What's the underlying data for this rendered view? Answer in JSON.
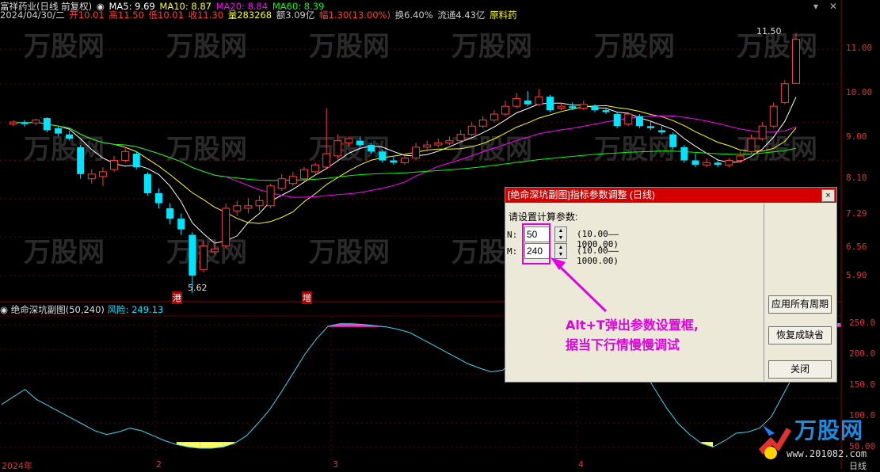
{
  "header": {
    "stock_name": "富祥药业(日线 前复权)",
    "ma5": "MA5: 9.69",
    "ma10": "MA10: 8.87",
    "ma20": "MA20: 8.84",
    "ma60": "MA60: 8.39",
    "date": "2024/04/30/二",
    "open": "开10.01",
    "high": "高11.50",
    "low": "低10.01",
    "close": "收11.30",
    "volume": "量283268",
    "amount": "额3.09亿",
    "change": "幅1.30(13.00%)",
    "turnover": "换6.40%",
    "float": "流通4.43亿",
    "sector": "原料药",
    "close_icon": "close-icon",
    "menu_icon": "chevron-down-icon"
  },
  "price_axis": [
    "11.00",
    "10.00",
    "9.00",
    "8.10",
    "7.29",
    "6.56",
    "5.90"
  ],
  "markers": {
    "high_label": "11.50",
    "low_label": "5.62",
    "tag1": "港",
    "tag2": "增"
  },
  "indicator": {
    "title": "绝命深坑副图(50,240)",
    "risk_label": "风险: 249.13",
    "axis": [
      "250.0",
      "200.0",
      "150.0",
      "100.0",
      "50.00"
    ]
  },
  "bottom_labels": [
    "2024年",
    "2",
    "3",
    "4",
    "日线"
  ],
  "dialog": {
    "title": "[绝命深坑副图]指标参数调整 (日线)",
    "close_label": "×",
    "prompt": "请设置计算参数:",
    "params": [
      {
        "name": "N:",
        "value": "50",
        "range": "(10.00——1000.00)"
      },
      {
        "name": "M:",
        "value": "240",
        "range": "(10.00——1000.00)"
      }
    ],
    "buttons": {
      "apply_all": "应用所有周期",
      "restore": "恢复成缺省",
      "close": "关闭"
    }
  },
  "annotation": {
    "line1": "Alt+T弹出参数设置框,",
    "line2": "据当下行情慢慢调试"
  },
  "logo": {
    "name": "万股网",
    "url": "www.201082.com"
  },
  "colors": {
    "up": "#ff3b3b",
    "down": "#00e5ff",
    "ma5": "#ffffff",
    "ma10": "#ffff00",
    "ma20": "#ff00ff",
    "ma60": "#00ff00",
    "dialog_title": "#d40000",
    "annotation": "#e000e0"
  },
  "candles": [
    {
      "o": 8.95,
      "c": 9.0,
      "h": 9.05,
      "l": 8.9
    },
    {
      "o": 9.0,
      "c": 8.95,
      "h": 9.05,
      "l": 8.88
    },
    {
      "o": 8.98,
      "c": 9.05,
      "h": 9.08,
      "l": 8.92
    },
    {
      "o": 9.1,
      "c": 8.8,
      "h": 9.12,
      "l": 8.75
    },
    {
      "o": 8.85,
      "c": 8.72,
      "h": 8.9,
      "l": 8.65
    },
    {
      "o": 8.7,
      "c": 8.6,
      "h": 8.78,
      "l": 8.55
    },
    {
      "o": 8.4,
      "c": 7.8,
      "h": 8.45,
      "l": 7.7
    },
    {
      "o": 7.7,
      "c": 7.8,
      "h": 7.9,
      "l": 7.6
    },
    {
      "o": 7.75,
      "c": 7.85,
      "h": 7.95,
      "l": 7.55
    },
    {
      "o": 7.9,
      "c": 8.1,
      "h": 8.2,
      "l": 7.85
    },
    {
      "o": 8.1,
      "c": 8.3,
      "h": 8.4,
      "l": 8.05
    },
    {
      "o": 8.25,
      "c": 7.95,
      "h": 8.3,
      "l": 7.9
    },
    {
      "o": 7.8,
      "c": 7.4,
      "h": 7.85,
      "l": 7.35
    },
    {
      "o": 7.4,
      "c": 7.2,
      "h": 7.5,
      "l": 7.1
    },
    {
      "o": 7.1,
      "c": 6.9,
      "h": 7.2,
      "l": 6.8
    },
    {
      "o": 6.9,
      "c": 6.7,
      "h": 7.0,
      "l": 6.6
    },
    {
      "o": 6.6,
      "c": 5.9,
      "h": 6.65,
      "l": 5.62
    },
    {
      "o": 6.0,
      "c": 6.4,
      "h": 6.5,
      "l": 5.95
    },
    {
      "o": 6.3,
      "c": 6.35,
      "h": 6.5,
      "l": 6.25
    },
    {
      "o": 6.4,
      "c": 7.1,
      "h": 7.2,
      "l": 6.35
    },
    {
      "o": 7.05,
      "c": 7.15,
      "h": 7.25,
      "l": 6.95
    },
    {
      "o": 7.1,
      "c": 7.15,
      "h": 7.3,
      "l": 7.0
    },
    {
      "o": 7.15,
      "c": 7.25,
      "h": 7.35,
      "l": 7.05
    },
    {
      "o": 7.15,
      "c": 7.55,
      "h": 7.6,
      "l": 7.1
    },
    {
      "o": 7.5,
      "c": 7.7,
      "h": 7.8,
      "l": 7.45
    },
    {
      "o": 7.6,
      "c": 7.75,
      "h": 7.85,
      "l": 7.55
    },
    {
      "o": 7.7,
      "c": 7.9,
      "h": 7.95,
      "l": 7.65
    },
    {
      "o": 7.85,
      "c": 8.0,
      "h": 8.05,
      "l": 7.8
    },
    {
      "o": 7.95,
      "c": 8.25,
      "h": 9.35,
      "l": 7.9
    },
    {
      "o": 8.2,
      "c": 8.55,
      "h": 8.7,
      "l": 8.15
    },
    {
      "o": 8.5,
      "c": 8.6,
      "h": 8.65,
      "l": 8.4
    },
    {
      "o": 8.55,
      "c": 8.45,
      "h": 8.65,
      "l": 8.4
    },
    {
      "o": 8.45,
      "c": 8.3,
      "h": 8.5,
      "l": 8.25
    },
    {
      "o": 8.3,
      "c": 8.1,
      "h": 8.35,
      "l": 8.05
    },
    {
      "o": 8.1,
      "c": 8.05,
      "h": 8.2,
      "l": 8.0
    },
    {
      "o": 8.05,
      "c": 8.15,
      "h": 8.25,
      "l": 8.0
    },
    {
      "o": 8.15,
      "c": 8.4,
      "h": 8.5,
      "l": 8.1
    },
    {
      "o": 8.4,
      "c": 8.45,
      "h": 8.55,
      "l": 8.3
    },
    {
      "o": 8.45,
      "c": 8.5,
      "h": 8.6,
      "l": 8.4
    },
    {
      "o": 8.5,
      "c": 8.55,
      "h": 8.65,
      "l": 8.45
    },
    {
      "o": 8.55,
      "c": 8.7,
      "h": 8.8,
      "l": 8.5
    },
    {
      "o": 8.7,
      "c": 8.9,
      "h": 9.0,
      "l": 8.65
    },
    {
      "o": 8.9,
      "c": 9.05,
      "h": 9.15,
      "l": 8.85
    },
    {
      "o": 9.05,
      "c": 9.2,
      "h": 9.3,
      "l": 9.0
    },
    {
      "o": 9.2,
      "c": 9.4,
      "h": 9.55,
      "l": 9.15
    },
    {
      "o": 9.4,
      "c": 9.6,
      "h": 9.75,
      "l": 9.35
    },
    {
      "o": 9.55,
      "c": 9.45,
      "h": 9.8,
      "l": 9.4
    },
    {
      "o": 9.45,
      "c": 9.65,
      "h": 9.85,
      "l": 9.4
    },
    {
      "o": 9.65,
      "c": 9.3,
      "h": 9.7,
      "l": 9.25
    },
    {
      "o": 9.35,
      "c": 9.4,
      "h": 9.5,
      "l": 9.3
    },
    {
      "o": 9.4,
      "c": 9.35,
      "h": 9.5,
      "l": 9.3
    },
    {
      "o": 9.35,
      "c": 9.45,
      "h": 9.55,
      "l": 9.3
    },
    {
      "o": 9.4,
      "c": 9.3,
      "h": 9.45,
      "l": 9.25
    },
    {
      "o": 9.3,
      "c": 9.25,
      "h": 9.35,
      "l": 9.2
    },
    {
      "o": 9.2,
      "c": 8.9,
      "h": 9.25,
      "l": 8.85
    },
    {
      "o": 8.95,
      "c": 9.2,
      "h": 9.25,
      "l": 8.9
    },
    {
      "o": 9.15,
      "c": 8.9,
      "h": 9.2,
      "l": 8.85
    },
    {
      "o": 8.9,
      "c": 8.85,
      "h": 9.0,
      "l": 8.8
    },
    {
      "o": 8.8,
      "c": 8.75,
      "h": 8.9,
      "l": 8.7
    },
    {
      "o": 8.7,
      "c": 8.4,
      "h": 8.75,
      "l": 8.35
    },
    {
      "o": 8.4,
      "c": 8.1,
      "h": 8.45,
      "l": 8.05
    },
    {
      "o": 8.1,
      "c": 8.0,
      "h": 8.25,
      "l": 7.95
    },
    {
      "o": 8.0,
      "c": 8.05,
      "h": 8.15,
      "l": 7.95
    },
    {
      "o": 8.05,
      "c": 8.0,
      "h": 8.1,
      "l": 7.95
    },
    {
      "o": 8.0,
      "c": 8.1,
      "h": 8.15,
      "l": 7.95
    },
    {
      "o": 8.1,
      "c": 8.2,
      "h": 8.3,
      "l": 8.05
    },
    {
      "o": 8.3,
      "c": 8.6,
      "h": 8.7,
      "l": 8.25
    },
    {
      "o": 8.6,
      "c": 8.9,
      "h": 9.0,
      "l": 8.55
    },
    {
      "o": 8.9,
      "c": 9.4,
      "h": 9.5,
      "l": 8.85
    },
    {
      "o": 9.5,
      "c": 10.0,
      "h": 10.1,
      "l": 9.45
    },
    {
      "o": 10.01,
      "c": 11.3,
      "h": 11.5,
      "l": 10.01
    }
  ],
  "indicator_values": [
    120,
    132,
    144,
    128,
    118,
    108,
    98,
    88,
    78,
    72,
    76,
    82,
    78,
    70,
    62,
    56,
    52,
    50,
    50,
    52,
    58,
    70,
    90,
    112,
    140,
    170,
    200,
    225,
    245,
    249,
    249,
    248,
    246,
    244,
    240,
    235,
    225,
    215,
    205,
    195,
    185,
    178,
    172,
    175,
    195,
    220,
    244,
    249,
    248,
    246,
    244,
    240,
    232,
    218,
    198,
    175,
    145,
    115,
    90,
    72,
    58,
    52,
    62,
    74,
    76,
    82,
    100,
    135,
    170,
    205,
    240,
    249,
    249
  ]
}
